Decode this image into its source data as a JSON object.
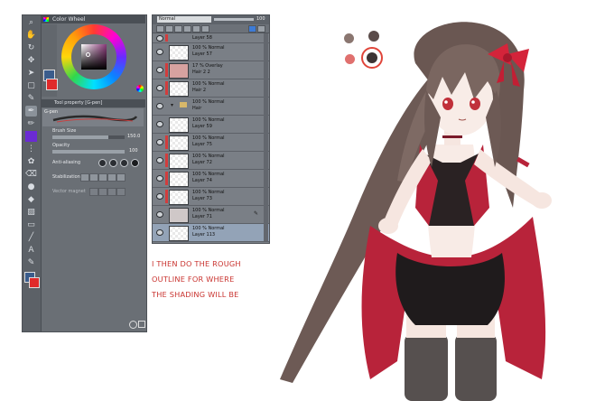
{
  "color_wheel_panel": {
    "title": "Color Wheel",
    "main_color": "#3a5c8c",
    "sub_color": "#e02a2a"
  },
  "tool_property": {
    "title": "Tool property [G-pen]",
    "brush_name": "G-pen",
    "brush_size_label": "Brush Size",
    "brush_size_value": "150.0",
    "opacity_label": "Opacity",
    "opacity_value": "100",
    "anti_aliasing_label": "Anti-aliasing",
    "stabilization_label": "Stabilization",
    "vector_magnet_label": "Vector magnet"
  },
  "layer_panel": {
    "blend_mode": "Normal",
    "opacity": "100",
    "layers": [
      {
        "mode": "",
        "name": "Layer 58"
      },
      {
        "mode": "100 % Normal",
        "name": "Layer 57"
      },
      {
        "mode": "17 % Overlay",
        "name": "Hair 2 2"
      },
      {
        "mode": "100 % Normal",
        "name": "Hair 2"
      },
      {
        "mode": "100 % Normal",
        "name": "Hair"
      },
      {
        "mode": "100 % Normal",
        "name": "Layer 59"
      },
      {
        "mode": "100 % Normal",
        "name": "Layer 75"
      },
      {
        "mode": "100 % Normal",
        "name": "Layer 72"
      },
      {
        "mode": "100 % Normal",
        "name": "Layer 74"
      },
      {
        "mode": "100 % Normal",
        "name": "Layer 73"
      },
      {
        "mode": "100 % Normal",
        "name": "Layer 71"
      },
      {
        "mode": "100 % Normal",
        "name": "Layer 113"
      }
    ]
  },
  "annotation": {
    "line1": "I THEN DO THE ROUGH",
    "line2": "OUTLINE FOR WHERE",
    "line3": "THE SHADING WILL BE"
  },
  "palette": {
    "colors": [
      "#8a7670",
      "#5b4c4a",
      "#e0706e",
      "#3d3434"
    ],
    "ring_color": "#e0453a"
  }
}
